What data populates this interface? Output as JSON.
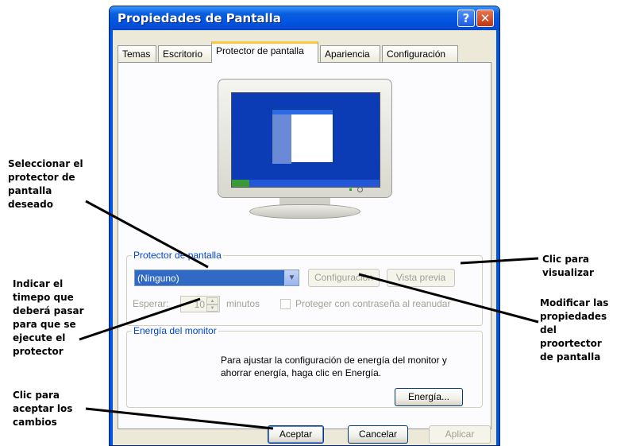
{
  "window": {
    "title": "Propiedades de Pantalla",
    "help_glyph": "?",
    "close_glyph": "✕"
  },
  "tabs": [
    "Temas",
    "Escritorio",
    "Protector de pantalla",
    "Apariencia",
    "Configuración"
  ],
  "active_tab": "Protector de pantalla",
  "screensaver": {
    "legend": "Protector de pantalla",
    "selected": "(Ninguno)",
    "settings_button": "Configuración",
    "preview_button": "Vista previa",
    "wait_label": "Esperar:",
    "wait_value": "10",
    "minutes_label": "minutos",
    "password_label": "Proteger con contraseña al reanudar"
  },
  "energy": {
    "legend": "Energía del monitor",
    "text": "Para ajustar la configuración de energía del monitor y ahorrar energía, haga clic en Energía.",
    "button": "Energía..."
  },
  "footer": {
    "accept": "Aceptar",
    "cancel": "Cancelar",
    "apply": "Aplicar"
  },
  "annotations": {
    "select_saver": "Seleccionar el protector de pantalla deseado",
    "wait_time": "Indicar el timepo que deberá pasar para que se ejecute el protector",
    "accept_changes": "Clic para aceptar los cambios",
    "preview": "Clic para visualizar",
    "modify": "Modificar las propiedades del proortector de pantalla"
  },
  "colors": {
    "titlebar": "#0053e1",
    "selection": "#316ac5",
    "legend_text": "#0046d5",
    "active_tab_accent": "#ffc83c"
  }
}
